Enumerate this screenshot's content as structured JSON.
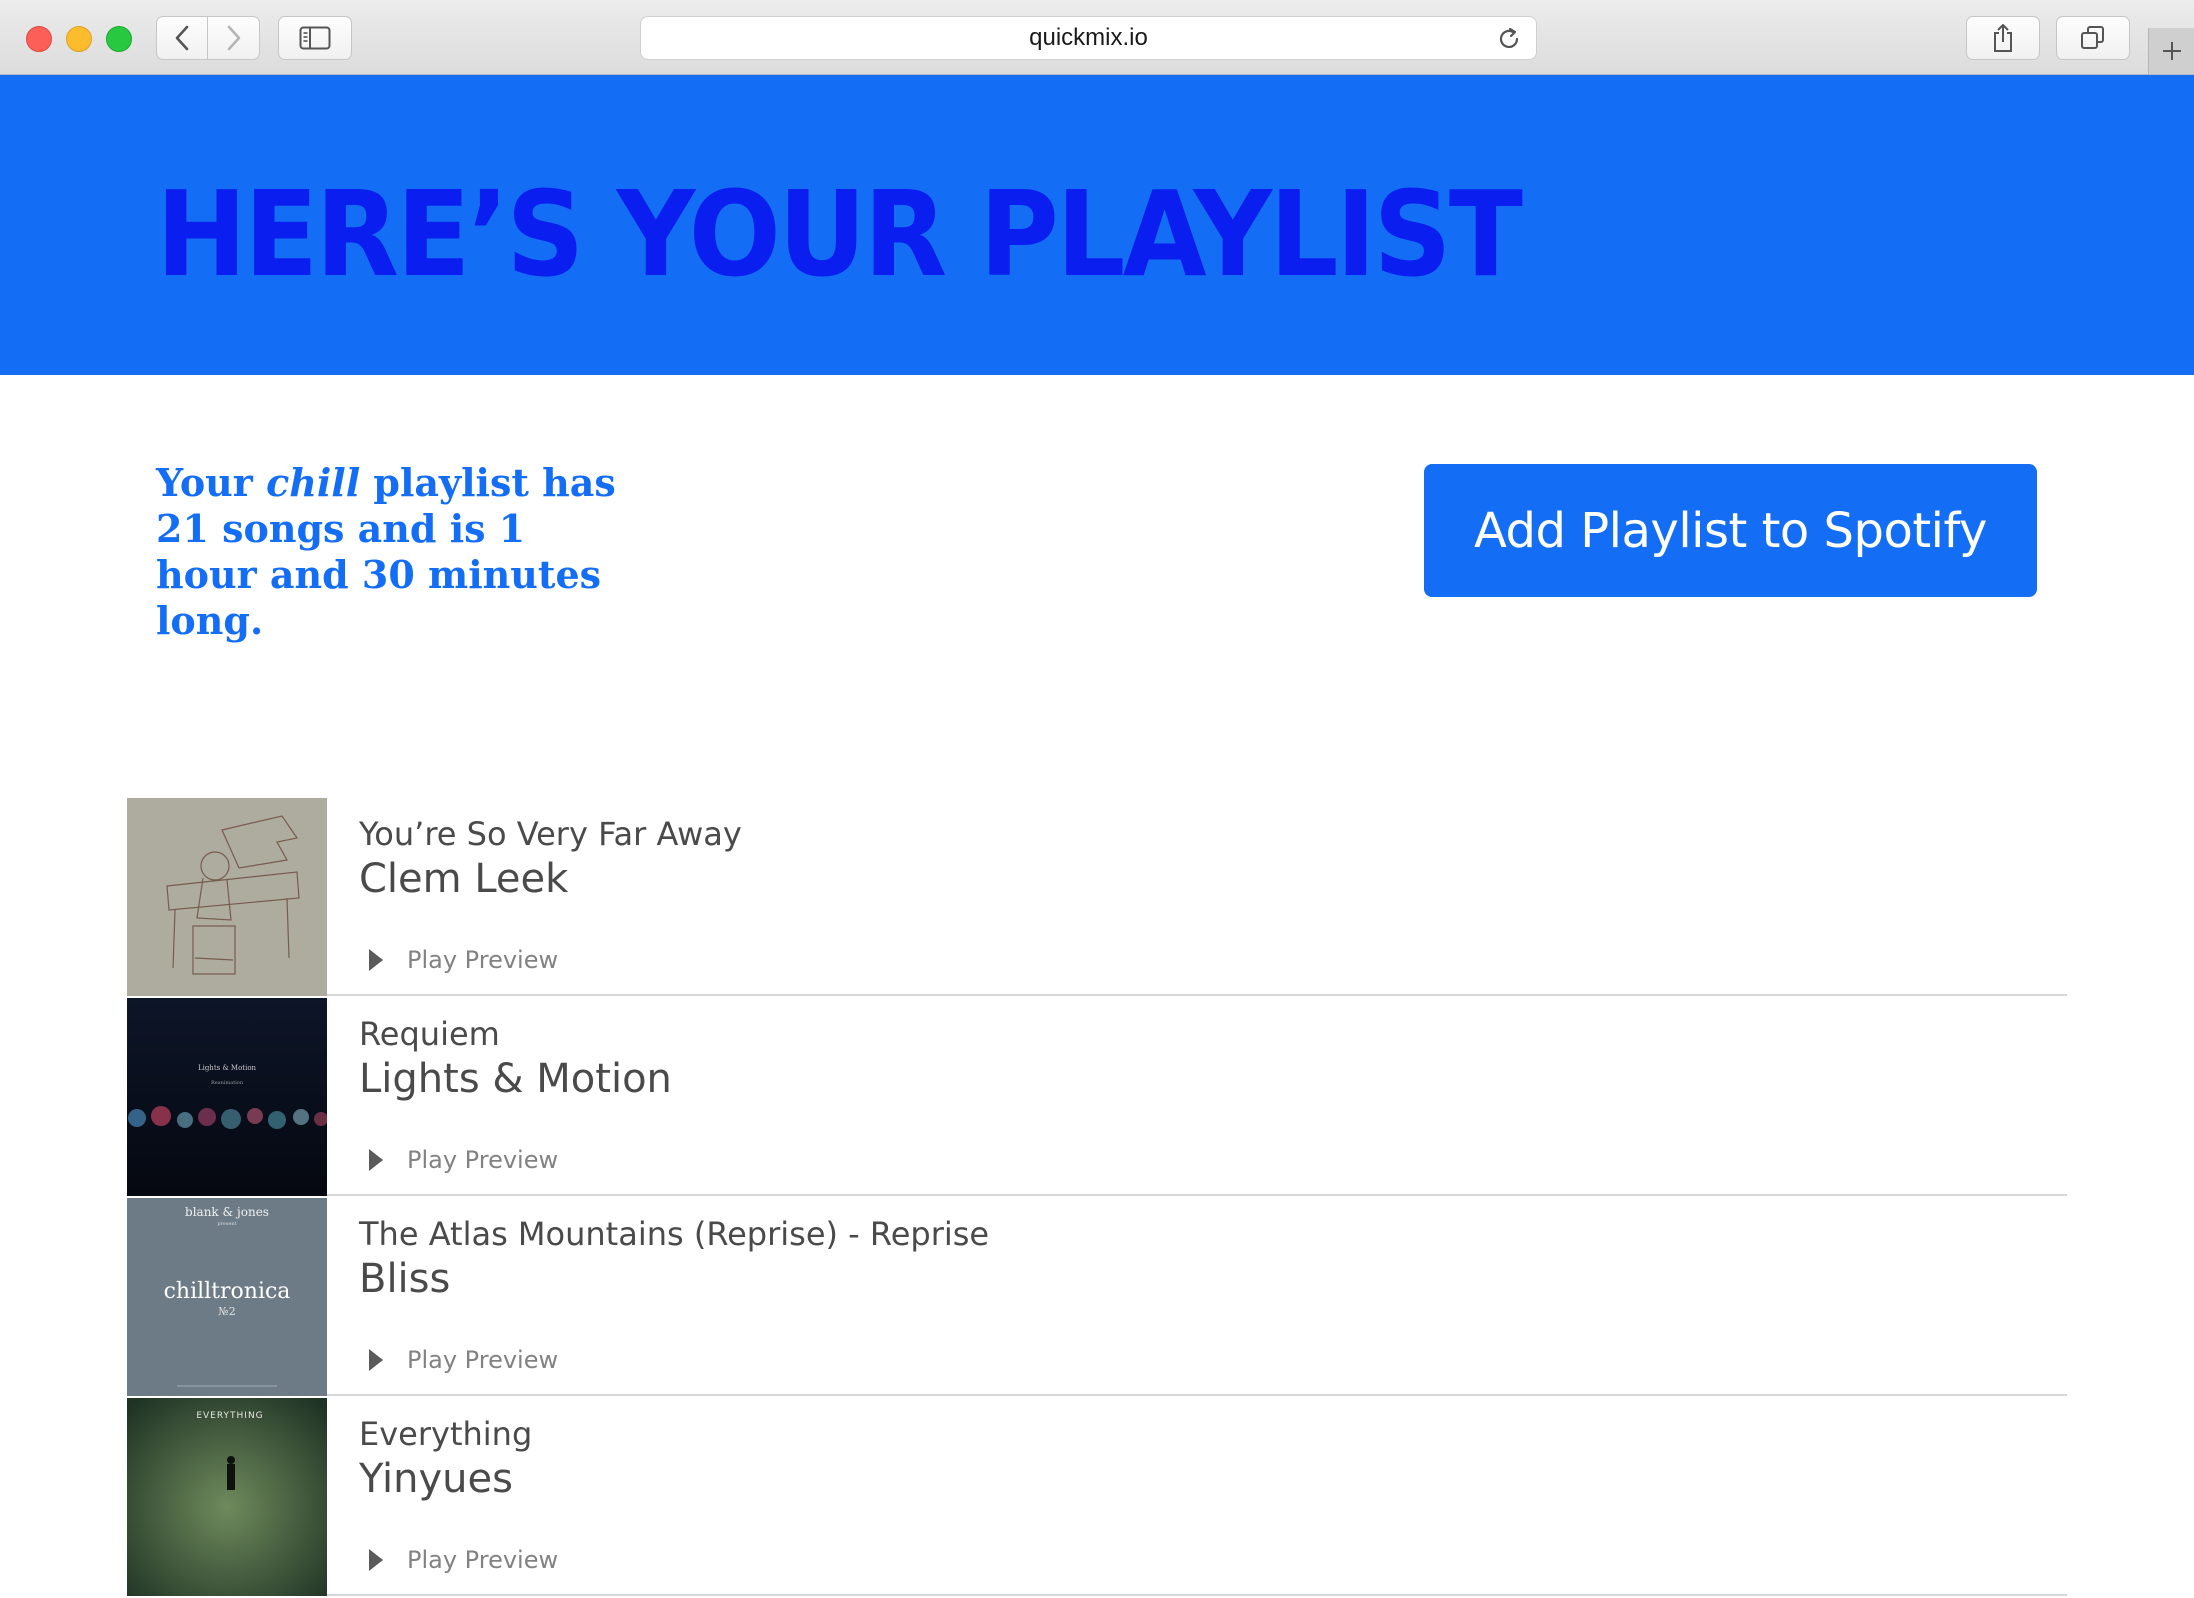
{
  "browser": {
    "url": "quickmix.io"
  },
  "hero": {
    "title": "HERE’S YOUR PLAYLIST"
  },
  "summary": {
    "prefix": "Your ",
    "mood": "chill",
    "suffix": " playlist has 21 songs and is 1 hour and 30 minutes long."
  },
  "actions": {
    "add_to_spotify": "Add Playlist to Spotify"
  },
  "colors": {
    "accent": "#146ef5",
    "hero_title": "#0a1ef0"
  },
  "tracks": [
    {
      "song": "You’re So Very Far Away",
      "artist": "Clem Leek",
      "play_label": "Play Preview"
    },
    {
      "song": "Requiem",
      "artist": "Lights & Motion",
      "play_label": "Play Preview",
      "art_text": [
        "Lights & Motion",
        "Reanimation"
      ]
    },
    {
      "song": "The Atlas Mountains (Reprise) - Reprise",
      "artist": "Bliss",
      "play_label": "Play Preview",
      "art_text": [
        "blank & jones",
        "present",
        "chilltronica",
        "№2"
      ]
    },
    {
      "song": "Everything",
      "artist": "Yinyues",
      "play_label": "Play Preview",
      "art_text": [
        "EVERYTHING"
      ]
    }
  ]
}
